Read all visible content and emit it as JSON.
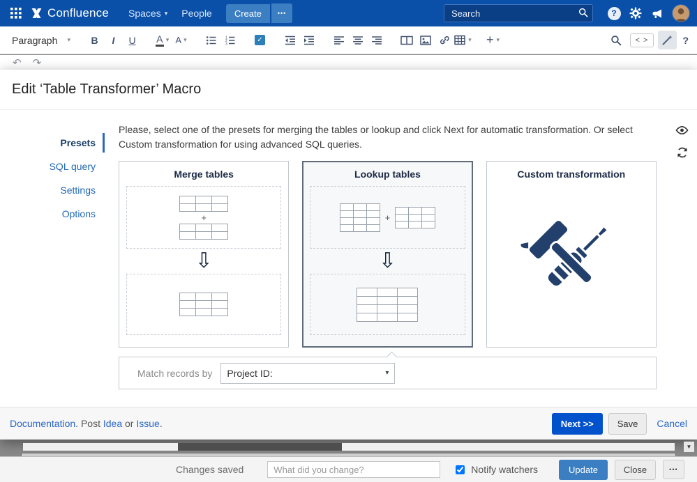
{
  "colors": {
    "navbar_bg": "#0a4fa8",
    "nav_button_blue": "#3b7ec2",
    "primary_blue": "#0052cc",
    "link_blue": "#2a67c5",
    "tool_icon_navy": "#22406b",
    "selected_card_border": "#5f6b7a"
  },
  "icons": {
    "caret": "▾",
    "undo": "↶",
    "redo": "↷",
    "arrow_down": "⇩",
    "plus": "+",
    "check": "✓",
    "scroll_down": "▼"
  },
  "navbar": {
    "brand": "Confluence",
    "spaces_label": "Spaces",
    "people_label": "People",
    "create_label": "Create",
    "more_label": "•••",
    "search_placeholder": "Search"
  },
  "editor_toolbar": {
    "paragraph_label": "Paragraph",
    "bold_label": "B",
    "italic_label": "I",
    "underline_label": "U",
    "text_color_label": "A",
    "more_format_label": "A",
    "code_label": "< >",
    "help_label": "?"
  },
  "dialog": {
    "title": "Edit ‘Table Transformer’ Macro",
    "tabs": [
      {
        "label": "Presets"
      },
      {
        "label": "SQL query"
      },
      {
        "label": "Settings"
      },
      {
        "label": "Options"
      }
    ],
    "description": "Please, select one of the presets for merging the tables or lookup and click Next for automatic transformation. Or select Custom transformation for using advanced SQL queries.",
    "presets": {
      "merge": {
        "title": "Merge tables"
      },
      "lookup": {
        "title": "Lookup tables"
      },
      "custom": {
        "title": "Custom transformation"
      }
    },
    "match": {
      "label": "Match records by",
      "value": "Project ID:"
    },
    "footer": {
      "documentation": "Documentation",
      "sep1": ". Post ",
      "idea": "Idea",
      "sep2": " or ",
      "issue": "Issue",
      "sep3": ".",
      "next": "Next >>",
      "save": "Save",
      "cancel": "Cancel"
    }
  },
  "bottom_bar": {
    "status": "Changes saved",
    "comment_placeholder": "What did you change?",
    "notify": "Notify watchers",
    "update": "Update",
    "close": "Close",
    "more": "•••"
  }
}
